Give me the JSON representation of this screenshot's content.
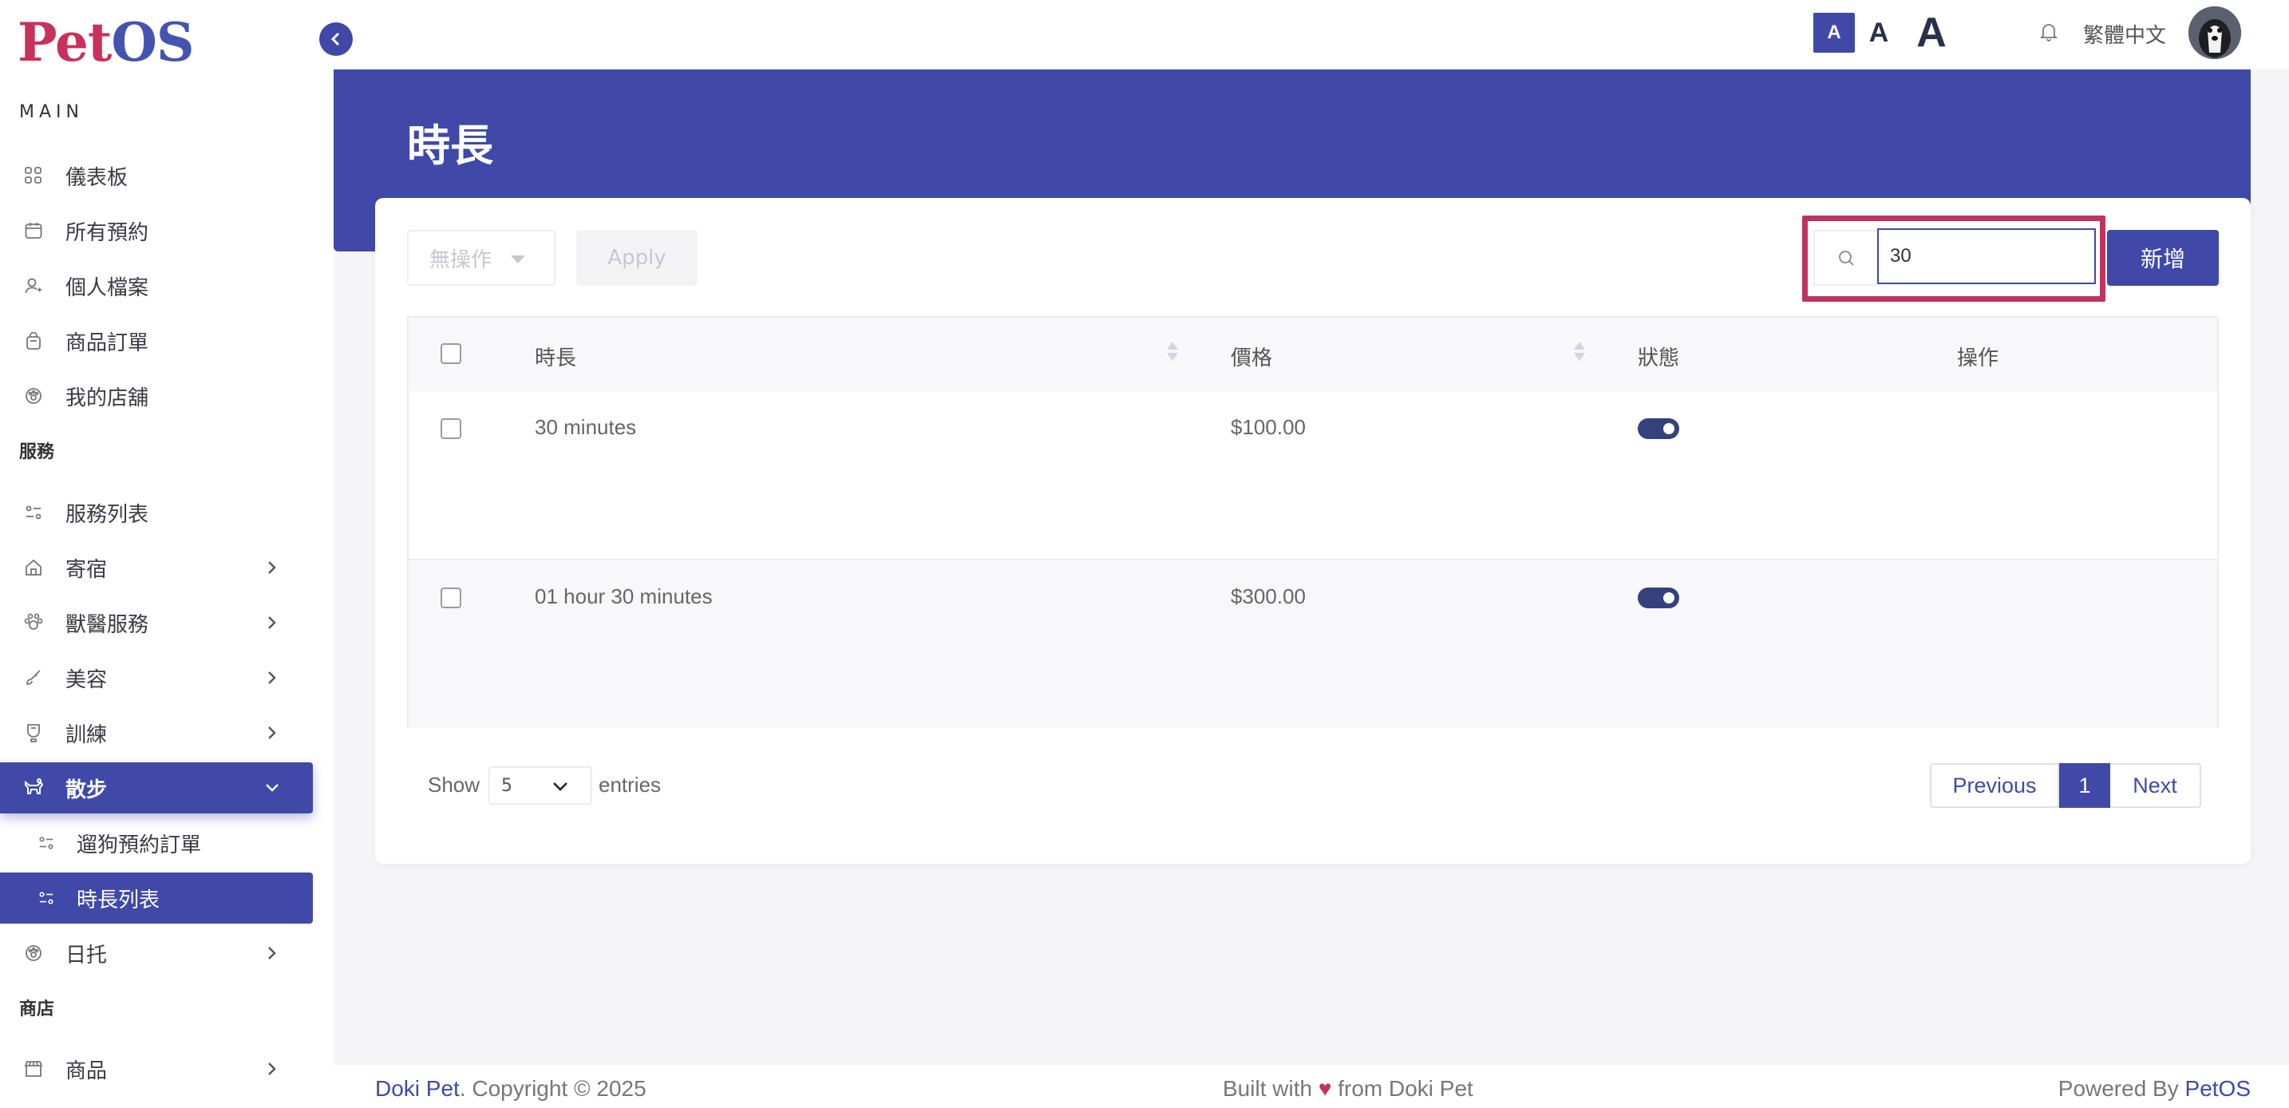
{
  "app": {
    "logo_pet": "Pet",
    "logo_os": "OS"
  },
  "topbar": {
    "font_small": "A",
    "font_medium": "A",
    "font_large": "A",
    "language": "繁體中文"
  },
  "sidebar": {
    "section_main": "MAIN",
    "section_services": "服務",
    "section_shop": "商店",
    "main_items": [
      {
        "label": "儀表板",
        "icon": "dashboard-icon"
      },
      {
        "label": "所有預約",
        "icon": "calendar-icon"
      },
      {
        "label": "個人檔案",
        "icon": "user-icon"
      },
      {
        "label": "商品訂單",
        "icon": "shopping-bag-icon"
      },
      {
        "label": "我的店舖",
        "icon": "paw-icon"
      }
    ],
    "service_items": [
      {
        "label": "服務列表",
        "icon": "list-icon"
      },
      {
        "label": "寄宿",
        "icon": "home-icon"
      },
      {
        "label": "獸醫服務",
        "icon": "paw-icon"
      },
      {
        "label": "美容",
        "icon": "brush-icon"
      },
      {
        "label": "訓練",
        "icon": "training-icon"
      },
      {
        "label": "散步",
        "icon": "dog-walk-icon"
      }
    ],
    "walk_sub_items": [
      {
        "label": "遛狗預約訂單"
      },
      {
        "label": "時長列表"
      }
    ],
    "daycare": {
      "label": "日托"
    },
    "shop_items": [
      {
        "label": "商品",
        "icon": "store-icon"
      }
    ]
  },
  "page": {
    "title": "時長"
  },
  "toolbar": {
    "bulk_action": "無操作",
    "apply_label": "Apply",
    "search_value": "30",
    "add_label": "新增"
  },
  "table": {
    "headers": [
      "時長",
      "價格",
      "狀態",
      "操作"
    ],
    "rows": [
      {
        "duration": "30 minutes",
        "price": "$100.00",
        "status_on": true
      },
      {
        "duration": "01 hour 30 minutes",
        "price": "$300.00",
        "status_on": true
      }
    ]
  },
  "pagination": {
    "show_label": "Show",
    "page_size": "5",
    "entries_label": "entries",
    "previous": "Previous",
    "current_page": "1",
    "next": "Next"
  },
  "footer": {
    "brand_left": "Doki Pet",
    "copyright": ". Copyright © 2025",
    "built_prefix": "Built with",
    "built_suffix": "from Doki Pet",
    "powered_prefix": "Powered By",
    "powered_brand": "PetOS"
  },
  "colors": {
    "primary": "#4049a8",
    "accent": "#c0335f",
    "logo_pink": "#c8325a"
  }
}
